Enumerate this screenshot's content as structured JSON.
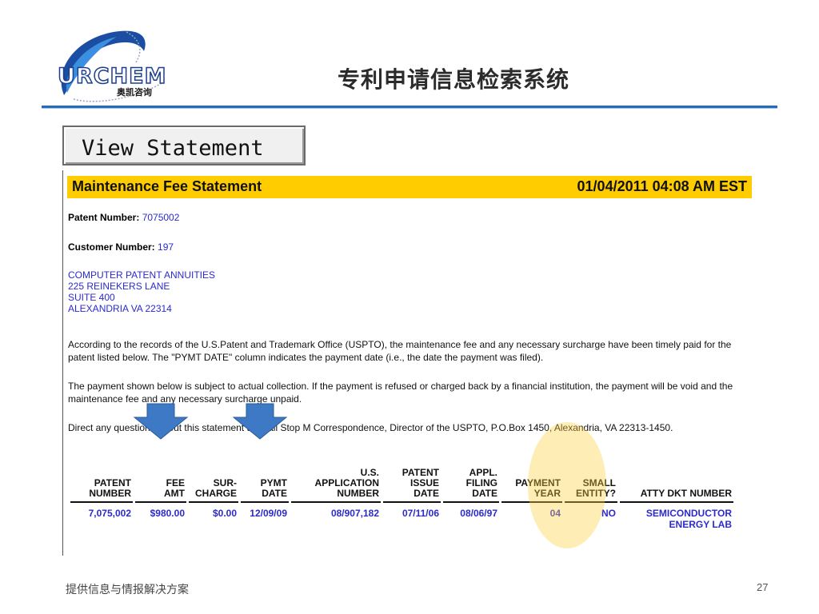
{
  "header": {
    "logo_text": "URCHEM",
    "logo_sub": "奥凯咨询",
    "title": "专利申请信息检索系统"
  },
  "view_button": {
    "label": "View Statement"
  },
  "statement": {
    "title": "Maintenance Fee Statement",
    "datetime": "01/04/2011 04:08 AM EST",
    "patent_number_label": "Patent Number:",
    "patent_number": "7075002",
    "customer_number_label": "Customer Number:",
    "customer_number": "197",
    "address": [
      "COMPUTER PATENT ANNUITIES",
      "225 REINEKERS LANE",
      "SUITE 400",
      "ALEXANDRIA VA 22314"
    ],
    "paragraphs": [
      "According to the records of the U.S.Patent and Trademark Office (USPTO), the maintenance fee and any necessary surcharge have been timely paid for the patent listed below. The \"PYMT DATE\" column indicates the payment date (i.e., the date the payment was filed).",
      "The payment shown below is subject to actual collection. If the payment is refused or charged back by a financial institution, the payment will be void and the maintenance fee and any necessary surcharge unpaid.",
      "Direct any questions about this statement to: Mail Stop M Correspondence, Director of the USPTO, P.O.Box 1450, Alexandria, VA 22313-1450."
    ],
    "table": {
      "headers": [
        [
          "PATENT",
          "NUMBER"
        ],
        [
          "FEE",
          "AMT"
        ],
        [
          "SUR-",
          "CHARGE"
        ],
        [
          "PYMT",
          "DATE"
        ],
        [
          "U.S.",
          "APPLICATION",
          "NUMBER"
        ],
        [
          "PATENT",
          "ISSUE",
          "DATE"
        ],
        [
          "APPL.",
          "FILING",
          "DATE"
        ],
        [
          "PAYMENT",
          "YEAR"
        ],
        [
          "SMALL",
          "ENTITY?"
        ],
        [
          "ATTY DKT NUMBER"
        ]
      ],
      "rows": [
        [
          [
            "7,075,002"
          ],
          [
            "$980.00"
          ],
          [
            "$0.00"
          ],
          [
            "12/09/09"
          ],
          [
            "08/907,182"
          ],
          [
            "07/11/06"
          ],
          [
            "08/06/97"
          ],
          [
            "04"
          ],
          [
            "NO"
          ],
          [
            "SEMICONDUCTOR",
            "ENERGY LAB"
          ]
        ]
      ]
    }
  },
  "colors": {
    "title_bar": "#ffcc00",
    "link_blue": "#2b2bcc",
    "arrow_blue": "#3d79c4",
    "highlight": "#fccf3c",
    "header_rule": "#2a6bb5"
  },
  "footer": {
    "text": "提供信息与情报解决方案",
    "page": "27"
  }
}
